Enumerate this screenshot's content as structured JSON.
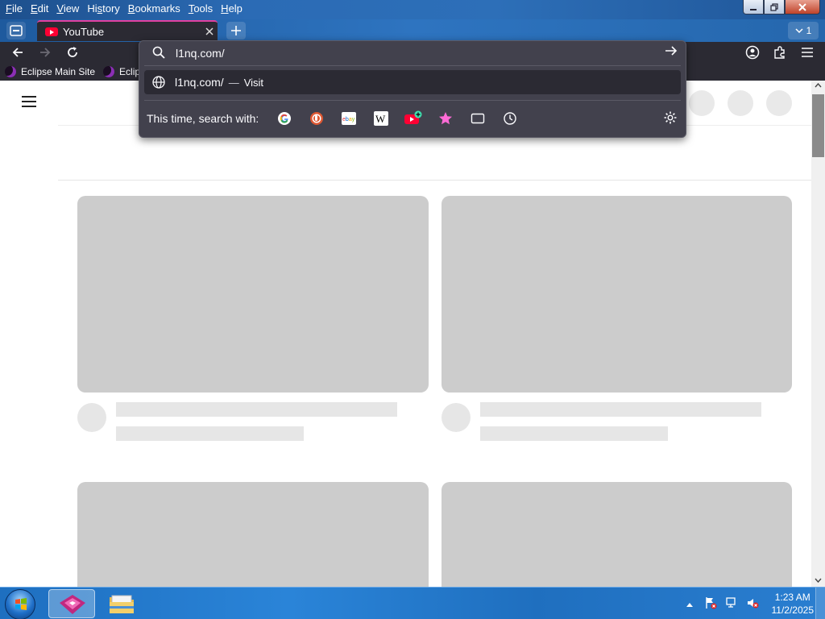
{
  "menubar": {
    "items": [
      {
        "label": "File",
        "underline": "F",
        "rest": "ile"
      },
      {
        "label": "Edit",
        "underline": "E",
        "rest": "dit"
      },
      {
        "label": "View",
        "underline": "V",
        "rest": "iew"
      },
      {
        "label": "History",
        "underline": "s",
        "pre": "Hi",
        "rest": "tory"
      },
      {
        "label": "Bookmarks",
        "underline": "B",
        "rest": "ookmarks"
      },
      {
        "label": "Tools",
        "underline": "T",
        "rest": "ools"
      },
      {
        "label": "Help",
        "underline": "H",
        "rest": "elp"
      }
    ]
  },
  "tabs": {
    "active_title": "YouTube",
    "count": "1"
  },
  "bookmarks": {
    "items": [
      "Eclipse Main Site",
      "Eclips"
    ]
  },
  "urlbar": {
    "value": "l1nq.com/",
    "result_text": "l1nq.com/",
    "result_dash": "—",
    "result_action": "Visit",
    "search_with_label": "This time, search with:",
    "engines": [
      "google-icon",
      "duckduckgo-icon",
      "ebay-icon",
      "wikipedia-icon",
      "youtube-add-icon",
      "bookmarks-star-icon",
      "tabs-icon",
      "history-icon"
    ]
  },
  "taskbar": {
    "time": "1:23 AM",
    "date": "11/2/2025"
  },
  "colors": {
    "accent": "#e040a0",
    "toolbar": "#2b2a33",
    "panel": "#42414d",
    "skeleton": "#cccccc"
  }
}
